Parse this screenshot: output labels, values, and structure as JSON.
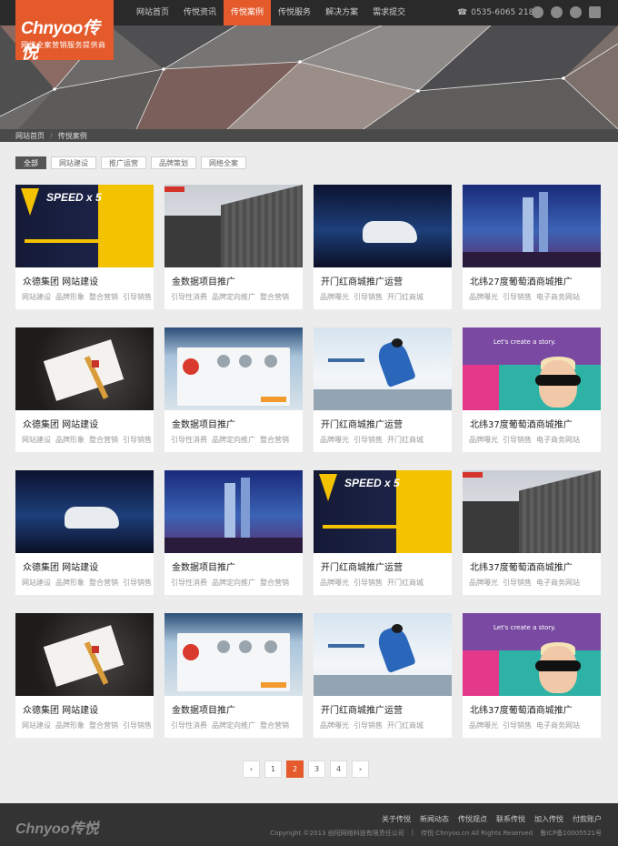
{
  "logo": {
    "wordmark": "Chnyoo传悦",
    "slogan": "网络全案营销服务提供商"
  },
  "nav": [
    {
      "label": "网站首页",
      "active": false
    },
    {
      "label": "传悦资讯",
      "active": false
    },
    {
      "label": "传悦案例",
      "active": true
    },
    {
      "label": "传悦服务",
      "active": false
    },
    {
      "label": "解决方案",
      "active": false
    },
    {
      "label": "需求提交",
      "active": false
    }
  ],
  "phone": "0535-6065 2189",
  "social_icons": [
    "qq-icon",
    "weibo-icon",
    "wechat-icon",
    "mail-icon"
  ],
  "breadcrumb": [
    "网站首页",
    "传悦案例"
  ],
  "filters": [
    {
      "label": "全部",
      "active": true
    },
    {
      "label": "网站建设",
      "active": false
    },
    {
      "label": "推广运营",
      "active": false
    },
    {
      "label": "品牌策划",
      "active": false
    },
    {
      "label": "网络全案",
      "active": false
    }
  ],
  "cases": [
    {
      "title": "众德集团 网站建设",
      "tags": [
        "网站建设",
        "品牌形象",
        "整合营销",
        "引导销售"
      ],
      "thumb": "speed"
    },
    {
      "title": "金数据项目推广",
      "tags": [
        "引导性消费",
        "品牌定向推广",
        "整合营销"
      ],
      "thumb": "build"
    },
    {
      "title": "开门红商城推广运营",
      "tags": [
        "品牌曝光",
        "引导销售",
        "开门红商城"
      ],
      "thumb": "car"
    },
    {
      "title": "北纬27度葡萄酒商城推广",
      "tags": [
        "品牌曝光",
        "引导销售",
        "电子商务网站"
      ],
      "thumb": "wine"
    },
    {
      "title": "众德集团 网站建设",
      "tags": [
        "网站建设",
        "品牌形象",
        "整合营销",
        "引导销售"
      ],
      "thumb": "paper"
    },
    {
      "title": "金数据项目推广",
      "tags": [
        "引导性消费",
        "品牌定向推广",
        "整合营销"
      ],
      "thumb": "web"
    },
    {
      "title": "开门红商城推广运营",
      "tags": [
        "品牌曝光",
        "引导销售",
        "开门红商城"
      ],
      "thumb": "ski"
    },
    {
      "title": "北纬37度葡萄酒商城推广",
      "tags": [
        "品牌曝光",
        "引导销售",
        "电子商务网站"
      ],
      "thumb": "purple"
    },
    {
      "title": "众德集团 网站建设",
      "tags": [
        "网站建设",
        "品牌形象",
        "整合营销",
        "引导销售"
      ],
      "thumb": "car"
    },
    {
      "title": "金数据项目推广",
      "tags": [
        "引导性消费",
        "品牌定向推广",
        "整合营销"
      ],
      "thumb": "wine"
    },
    {
      "title": "开门红商城推广运营",
      "tags": [
        "品牌曝光",
        "引导销售",
        "开门红商城"
      ],
      "thumb": "speed"
    },
    {
      "title": "北纬37度葡萄酒商城推广",
      "tags": [
        "品牌曝光",
        "引导销售",
        "电子商务网站"
      ],
      "thumb": "build"
    },
    {
      "title": "众德集团 网站建设",
      "tags": [
        "网站建设",
        "品牌形象",
        "整合营销",
        "引导销售"
      ],
      "thumb": "paper"
    },
    {
      "title": "金数据项目推广",
      "tags": [
        "引导性消费",
        "品牌定向推广",
        "整合营销"
      ],
      "thumb": "web"
    },
    {
      "title": "开门红商城推广运营",
      "tags": [
        "品牌曝光",
        "引导销售",
        "开门红商城"
      ],
      "thumb": "ski"
    },
    {
      "title": "北纬37度葡萄酒商城推广",
      "tags": [
        "品牌曝光",
        "引导销售",
        "电子商务网站"
      ],
      "thumb": "purple"
    }
  ],
  "thumb_text": {
    "speed": "SPEED x 5",
    "purple": "Let's create a story."
  },
  "pagination": {
    "prev": "‹",
    "pages": [
      "1",
      "2",
      "3",
      "4"
    ],
    "current": "2",
    "next": "›"
  },
  "footer": {
    "wordmark": "Chnyoo传悦",
    "links": [
      "关于传悦",
      "新闻动态",
      "传悦观点",
      "联系传悦",
      "加入传悦",
      "付款账户"
    ],
    "copyright": "Copyright ©2013 创阳网络科技有限责任公司",
    "domain": "传悦 Chnyoo.cn All Rights Reserved",
    "icp": "鲁ICP备10005521号"
  },
  "colors": {
    "accent": "#e45a2b",
    "header": "#2a2a2a",
    "footer": "#333333",
    "page_bg": "#ececec"
  }
}
